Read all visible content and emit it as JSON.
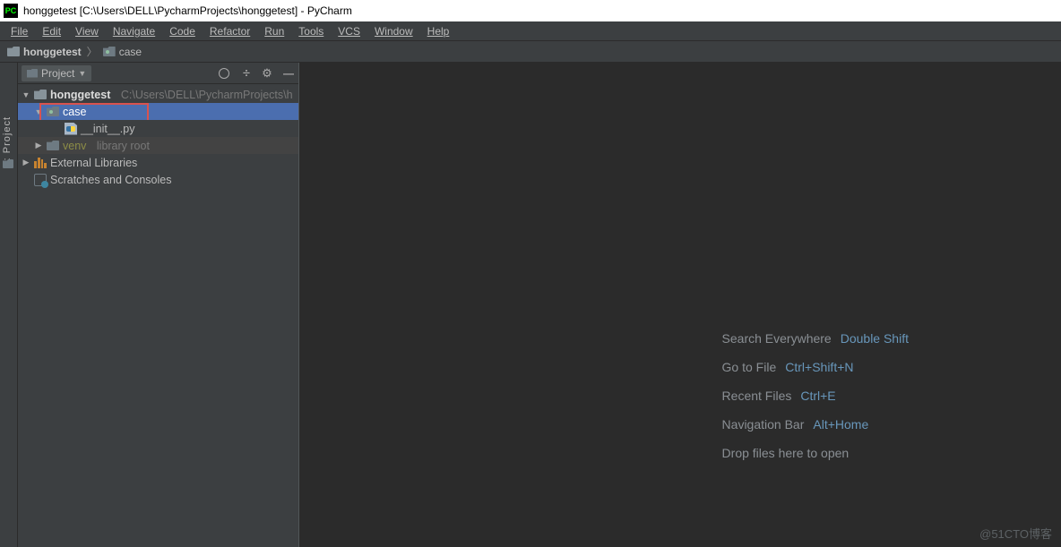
{
  "titlebar": {
    "text": "honggetest [C:\\Users\\DELL\\PycharmProjects\\honggetest] - PyCharm",
    "icon_label": "PC"
  },
  "menu": [
    "File",
    "Edit",
    "View",
    "Navigate",
    "Code",
    "Refactor",
    "Run",
    "Tools",
    "VCS",
    "Window",
    "Help"
  ],
  "breadcrumb": {
    "root": "honggetest",
    "child": "case"
  },
  "toolstrip": {
    "project_tab": "1: Project"
  },
  "project_pane": {
    "title": "Project",
    "tree": {
      "root": {
        "name": "honggetest",
        "path": "C:\\Users\\DELL\\PycharmProjects\\h"
      },
      "case": {
        "name": "case"
      },
      "init": {
        "name": "__init__.py"
      },
      "venv": {
        "name": "venv",
        "hint": "library root"
      },
      "ext_libs": {
        "name": "External Libraries"
      },
      "scratches": {
        "name": "Scratches and Consoles"
      }
    }
  },
  "tips": [
    {
      "label": "Search Everywhere",
      "shortcut": "Double Shift"
    },
    {
      "label": "Go to File",
      "shortcut": "Ctrl+Shift+N"
    },
    {
      "label": "Recent Files",
      "shortcut": "Ctrl+E"
    },
    {
      "label": "Navigation Bar",
      "shortcut": "Alt+Home"
    },
    {
      "label": "Drop files here to open",
      "shortcut": ""
    }
  ],
  "watermark": "@51CTO博客"
}
